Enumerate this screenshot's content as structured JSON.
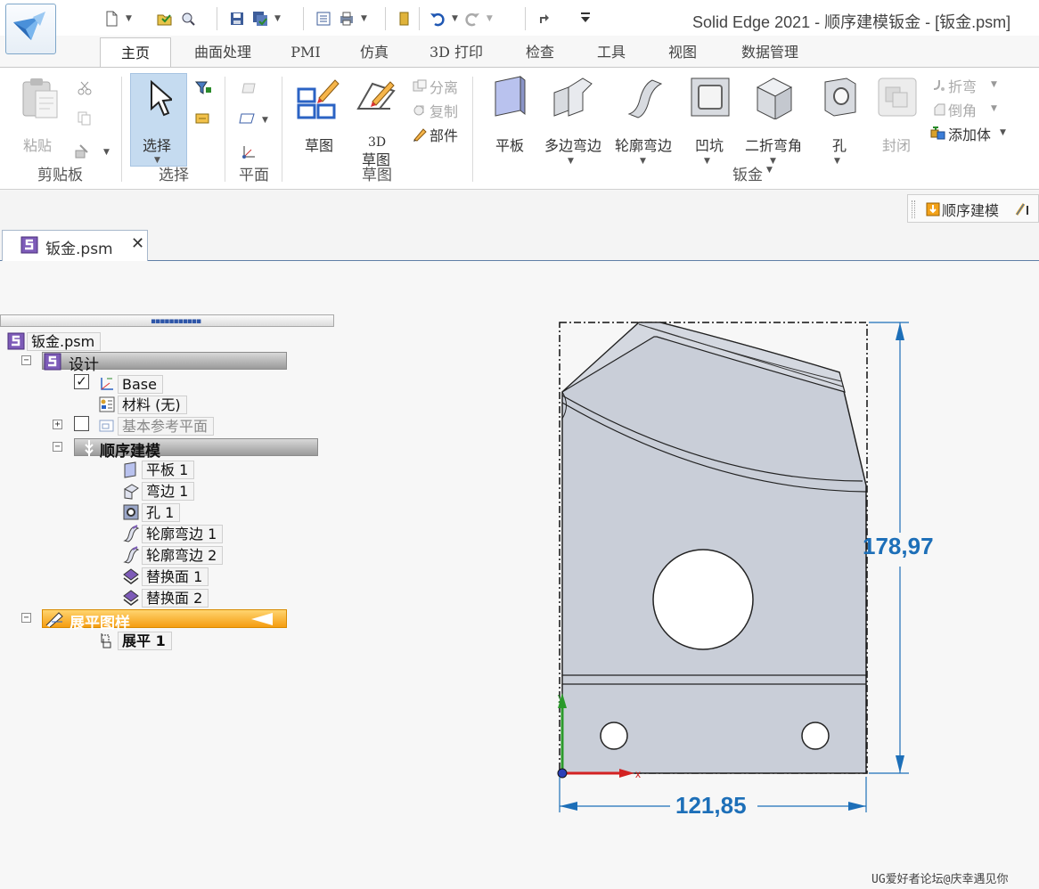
{
  "app": {
    "window_title": "Solid Edge 2021 - 顺序建模钣金 - [钣金.psm]"
  },
  "quick_access": {
    "icons": [
      "new-document-icon",
      "open-icon",
      "search-icon",
      "save-icon",
      "save-all-icon",
      "properties-icon",
      "print-icon",
      "bookmark-icon",
      "undo-icon",
      "redo-icon",
      "repeat-icon",
      "customize-icon"
    ]
  },
  "ribbon": {
    "tabs": [
      "主页",
      "曲面处理",
      "PMI",
      "仿真",
      "3D 打印",
      "检查",
      "工具",
      "视图",
      "数据管理"
    ],
    "active_tab": "主页",
    "clipboard": {
      "paste": "粘贴",
      "group": "剪贴板"
    },
    "select": {
      "select": "选择",
      "group": "选择"
    },
    "plane": {
      "group": "平面"
    },
    "sketch": {
      "sketch": "草图",
      "sketch3d_line1": "3D",
      "sketch3d_line2": "草图",
      "group": "草图"
    },
    "part_tools": {
      "separate": "分离",
      "copy": "复制",
      "part": "部件"
    },
    "sheetmetal": {
      "tab": "平板",
      "multi_flange": "多边弯边",
      "contour_flange": "轮廓弯边",
      "dimple": "凹坑",
      "jog": "二折弯角",
      "hole": "孔",
      "close_corner": "封闭",
      "bend": "折弯",
      "chamfer": "倒角",
      "add_body": "添加体",
      "group": "钣金"
    }
  },
  "mode_indicator": {
    "label": "顺序建模"
  },
  "document_tab": {
    "name": "钣金.psm",
    "close": "✕"
  },
  "pathfinder": {
    "root": "钣金.psm",
    "design": "设计",
    "base": "Base",
    "material": "材料 (无)",
    "ref_planes": "基本参考平面",
    "ordered": "顺序建模",
    "features": [
      "平板 1",
      "弯边 1",
      "孔 1",
      "轮廓弯边 1",
      "轮廓弯边 2",
      "替换面 1",
      "替换面 2"
    ],
    "flat_pattern": "展平图样",
    "flatten": "展平 1",
    "expand_minus": "−",
    "expand_plus": "+",
    "check": "✓"
  },
  "dimensions": {
    "height": "178,97",
    "width": "121,85"
  },
  "watermark": "UG爱好者论坛@庆幸遇见你",
  "colors": {
    "accent": "#1d6fb8",
    "select_highlight": "#c5dbf0",
    "flat_pattern_header": "#f5a623",
    "part_face": "#c9ced8"
  }
}
